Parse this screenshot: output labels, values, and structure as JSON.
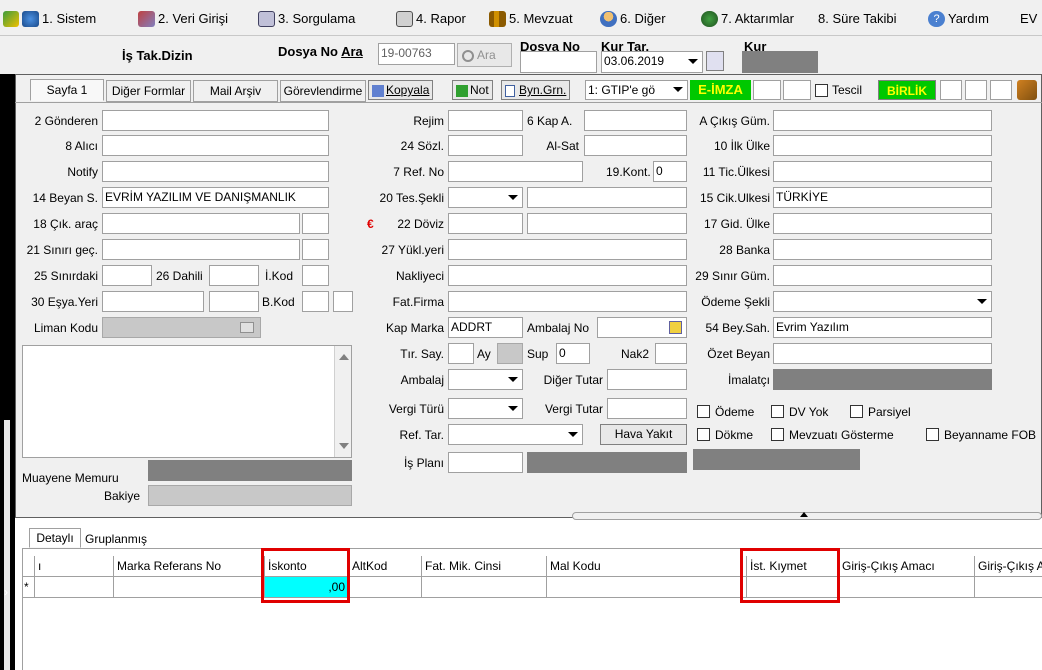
{
  "menu": {
    "items": [
      "1. Sistem",
      "2. Veri Girişi",
      "3. Sorgulama",
      "4. Rapor",
      "5. Mevzuat",
      "6. Diğer",
      "7. Aktarımlar",
      "8. Süre Takibi",
      "Yardım",
      "EV"
    ]
  },
  "header": {
    "title": "İş Tak.Dizin",
    "dosya_no_label": "Dosya No",
    "ara_label": "Ara",
    "dosya_no_value": "19-00763",
    "ara_button": "Ara",
    "dosya_no_col": "Dosya No",
    "kur_tar_label": "Kur Tar.",
    "kur_tar_value": "03.06.2019",
    "kur_label": "Kur"
  },
  "tabs": {
    "sayfa": "Sayfa 1",
    "diger": "Diğer Formlar",
    "mail": "Mail Arşiv",
    "gorev": "Görevlendirme",
    "kopyala": "Kopyala",
    "not": "Not",
    "byn": "Byn.Grn.",
    "gtip": "1: GTIP'e gö",
    "eimza": "E-İMZA",
    "tescil": "Tescil",
    "birlik": "BİRLİK"
  },
  "left": {
    "gonderen": "2 Gönderen",
    "alici": "8 Alıcı",
    "notify": "Notify",
    "beyan": "14 Beyan S.",
    "beyan_value": "EVRİM YAZILIM VE DANIŞMANLIK",
    "cik_arac": "18 Çık. araç",
    "sinir_gec": "21 Sınırı geç.",
    "sinirdaki": "25 Sınırdaki",
    "dahili": "26 Dahili",
    "ikod": "İ.Kod",
    "esya": "30 Eşya.Yeri",
    "bkod": "B.Kod",
    "liman": "Liman Kodu",
    "muayene": "Muayene Memuru",
    "bakiye": "Bakiye"
  },
  "middle": {
    "rejim": "Rejim",
    "kap_a": "6 Kap A.",
    "sozl": "24 Sözl.",
    "al_sat": "Al-Sat",
    "ref_no": "7 Ref. No",
    "kont": "19.Kont.",
    "kont_value": "0",
    "tes_sekli": "20 Tes.Şekli",
    "doviz": "22 Döviz",
    "euro_sign": "€",
    "yukl": "27 Yükl.yeri",
    "nakliyeci": "Nakliyeci",
    "fat_firma": "Fat.Firma",
    "kap_marka": "Kap Marka",
    "kap_marka_value": "ADDRT",
    "ambalaj_no": "Ambalaj No",
    "tir_say": "Tır. Say.",
    "ay": "Ay",
    "sup": "Sup",
    "sup_value": "0",
    "nak2": "Nak2",
    "ambalaj": "Ambalaj",
    "diger_tutar": "Diğer Tutar",
    "vergi_turu": "Vergi Türü",
    "vergi_tutar": "Vergi Tutar",
    "ref_tar": "Ref. Tar.",
    "hava_yakit": "Hava Yakıt",
    "is_plani": "İş Planı"
  },
  "right": {
    "cikis_gum": "A Çıkış Güm.",
    "ilk_ulke": "10 İlk Ülke",
    "tic_ulkesi": "11 Tic.Ülkesi",
    "cik_ulkesi": "15 Cik.Ulkesi",
    "cik_ulkesi_value": "TÜRKİYE",
    "gid_ulke": "17 Gid. Ülke",
    "banka": "28 Banka",
    "sinir_gum": "29 Sınır Güm.",
    "odeme_sekli": "Ödeme Şekli",
    "bey_sah": "54 Bey.Sah.",
    "bey_sah_value": "Evrim Yazılım",
    "ozet": "Özet Beyan",
    "imalatci": "İmalatçı",
    "cb_odeme": "Ödeme",
    "cb_dv": "DV Yok",
    "cb_parsiyel": "Parsiyel",
    "cb_dokme": "Dökme",
    "cb_mevzuat": "Mevzuatı Gösterme",
    "cb_beyanname": "Beyanname FOB"
  },
  "grid": {
    "tab_detay": "Detaylı",
    "tab_grup": "Gruplanmış",
    "cols": [
      "ı",
      "Marka Referans No",
      "İskonto",
      "AltKod",
      "Fat. Mik. Cinsi",
      "Mal Kodu",
      "İst. Kıymet",
      "Giriş-Çıkış Amacı",
      "Giriş-Çıkış A"
    ],
    "new_row_marker": "*",
    "iskonto_value": ",00"
  },
  "colors": {
    "highlight": "#e00000",
    "cell_cyan": "#00ffff",
    "eimza_green": "#00c800"
  }
}
